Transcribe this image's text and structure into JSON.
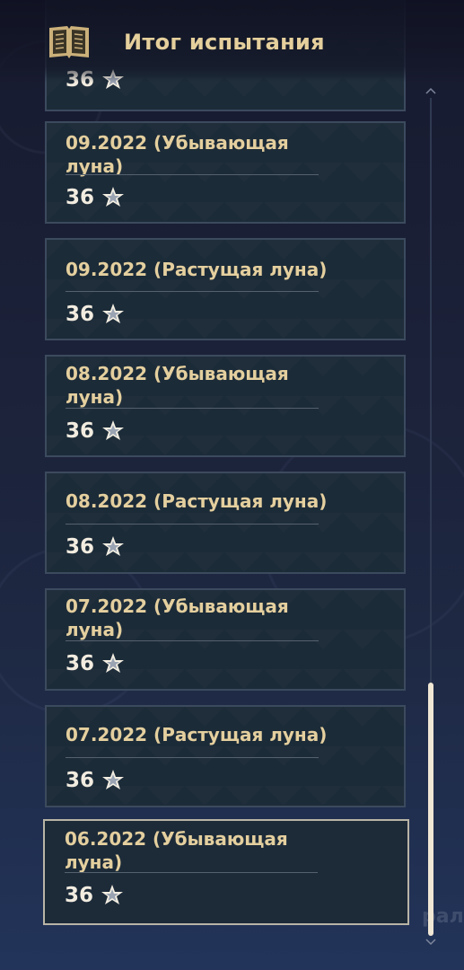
{
  "header": {
    "title": "Итог испытания",
    "icon": "book-icon"
  },
  "records": [
    {
      "title": "",
      "score": "36"
    },
    {
      "title": "09.2022 (Убывающая луна)",
      "score": "36"
    },
    {
      "title": "09.2022 (Растущая луна)",
      "score": "36"
    },
    {
      "title": "08.2022 (Убывающая луна)",
      "score": "36"
    },
    {
      "title": "08.2022 (Растущая луна)",
      "score": "36"
    },
    {
      "title": "07.2022 (Убывающая луна)",
      "score": "36"
    },
    {
      "title": "07.2022 (Растущая луна)",
      "score": "36"
    },
    {
      "title": "06.2022 (Убывающая луна)",
      "score": "36"
    }
  ],
  "background_text": "раль",
  "icons": {
    "score_icon": "abyss-star-icon",
    "scroll_up": "chevron-up-icon",
    "scroll_down": "chevron-down-icon"
  },
  "colors": {
    "title_gold": "#e5cf9c",
    "card_bg": "#1c2b38",
    "card_border": "#3c4a5e",
    "selected_border": "#b9b4a6",
    "scroll_thumb": "#efe6d4"
  }
}
